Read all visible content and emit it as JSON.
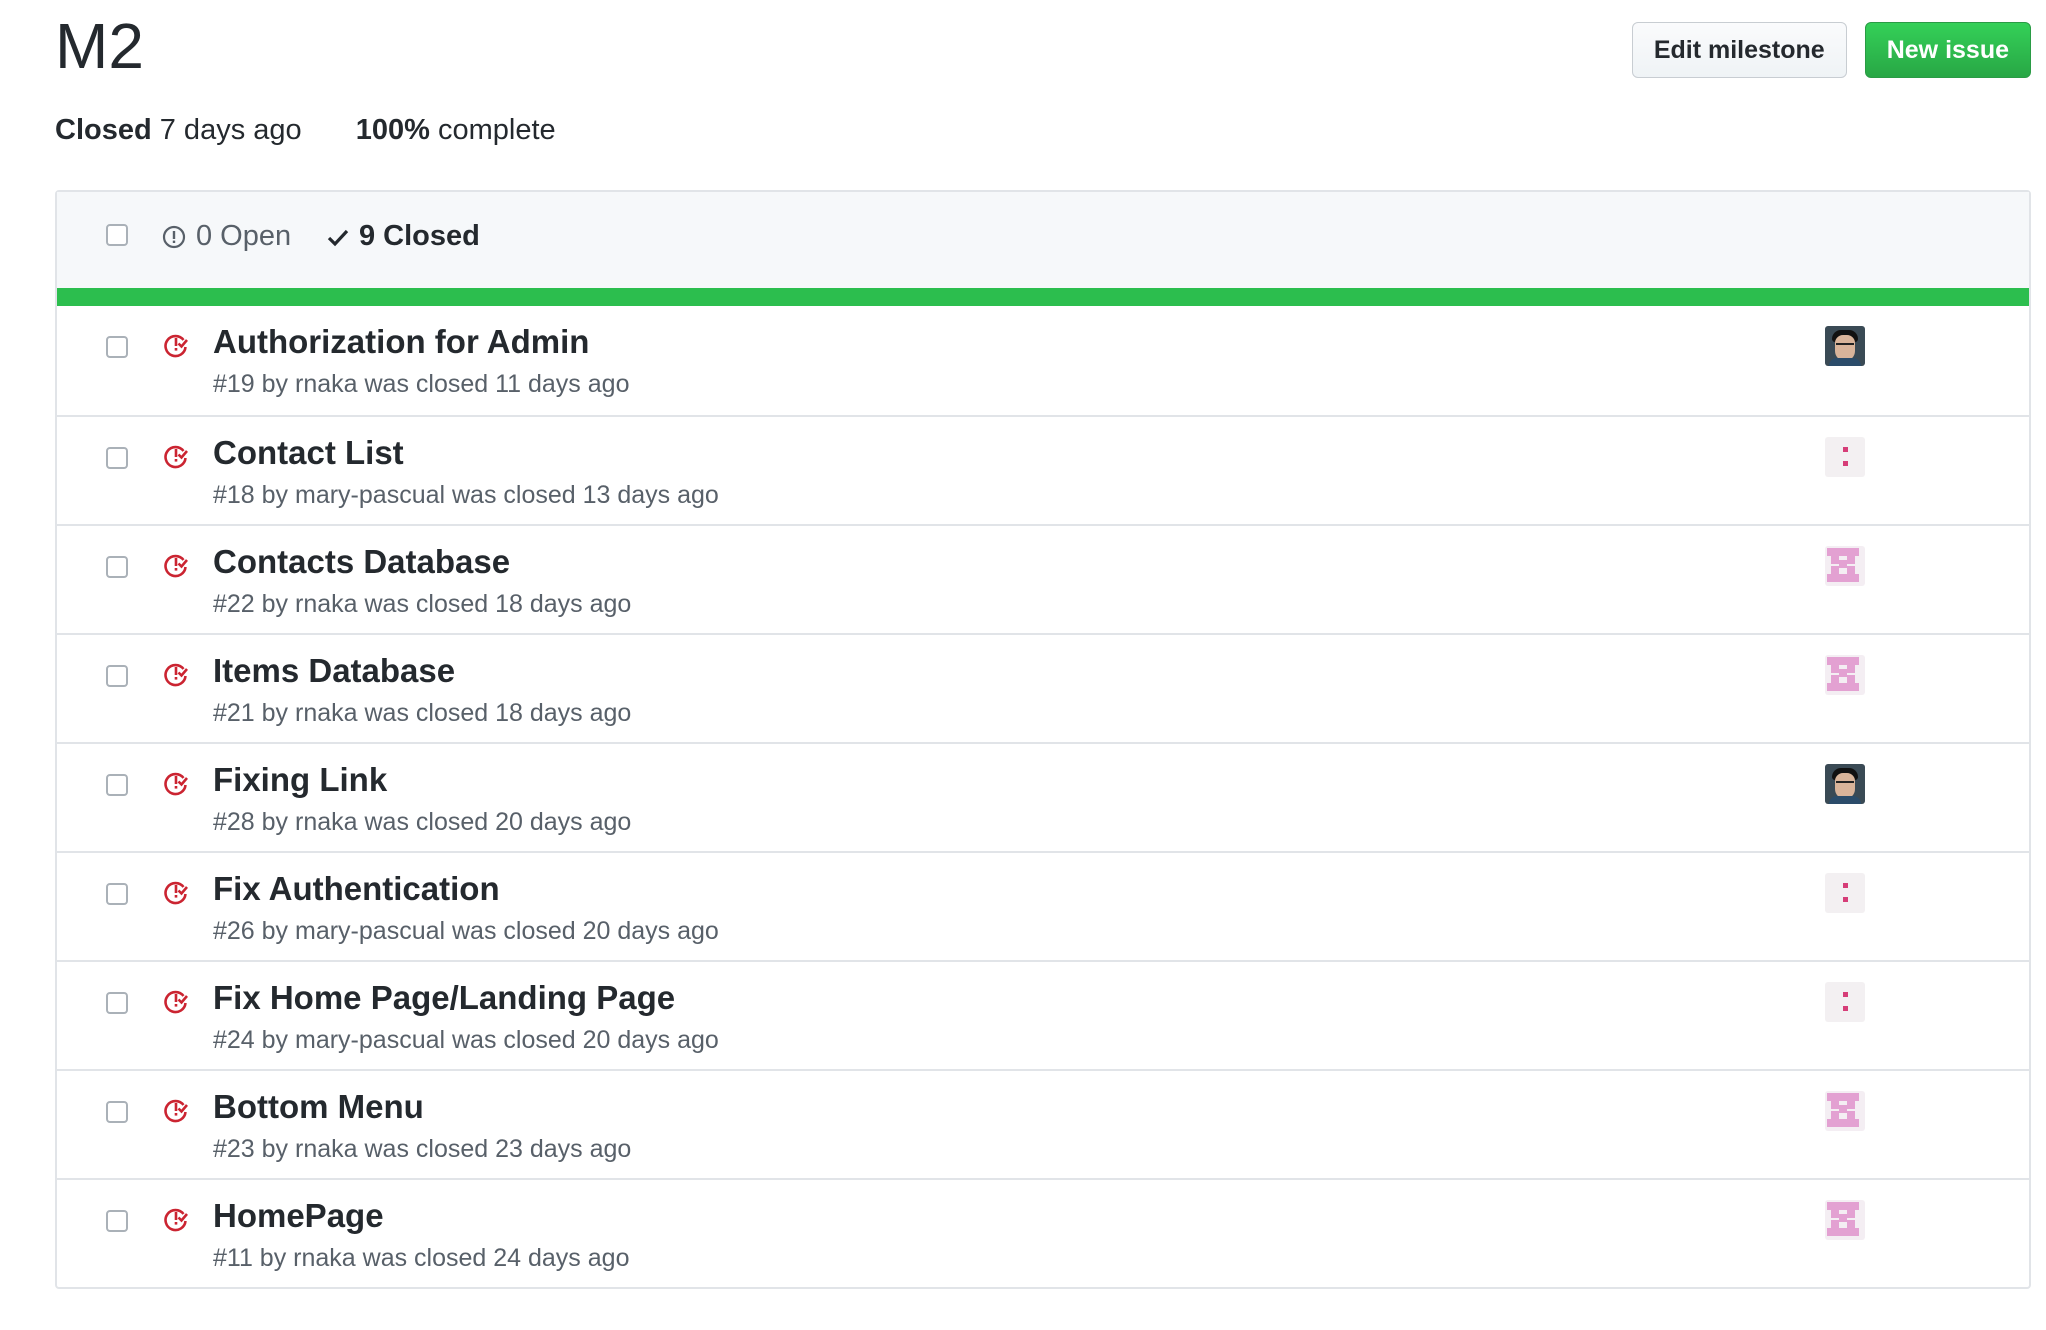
{
  "milestone": {
    "title": "M2",
    "status_label": "Closed",
    "status_time": "7 days ago",
    "percent": "100%",
    "percent_label": "complete",
    "progress": 1.0
  },
  "actions": {
    "edit_label": "Edit milestone",
    "new_label": "New issue"
  },
  "filters": {
    "open_label": "0 Open",
    "closed_label": "9 Closed"
  },
  "colors": {
    "accent_green": "#2cbe4e",
    "closed_icon_red": "#cb2431",
    "text_primary": "#24292e",
    "text_muted": "#586069"
  },
  "issues": [
    {
      "title": "Authorization for Admin",
      "meta": "#19 by rnaka was closed 11 days ago",
      "avatar": "photo"
    },
    {
      "title": "Contact List",
      "meta": "#18 by mary-pascual was closed 13 days ago",
      "avatar": "dots"
    },
    {
      "title": "Contacts Database",
      "meta": "#22 by rnaka was closed 18 days ago",
      "avatar": "pixel"
    },
    {
      "title": "Items Database",
      "meta": "#21 by rnaka was closed 18 days ago",
      "avatar": "pixel"
    },
    {
      "title": "Fixing Link",
      "meta": "#28 by rnaka was closed 20 days ago",
      "avatar": "photo"
    },
    {
      "title": "Fix Authentication",
      "meta": "#26 by mary-pascual was closed 20 days ago",
      "avatar": "dots"
    },
    {
      "title": "Fix Home Page/Landing Page",
      "meta": "#24 by mary-pascual was closed 20 days ago",
      "avatar": "dots"
    },
    {
      "title": "Bottom Menu",
      "meta": "#23 by rnaka was closed 23 days ago",
      "avatar": "pixel"
    },
    {
      "title": "HomePage",
      "meta": "#11 by rnaka was closed 24 days ago",
      "avatar": "pixel"
    }
  ]
}
